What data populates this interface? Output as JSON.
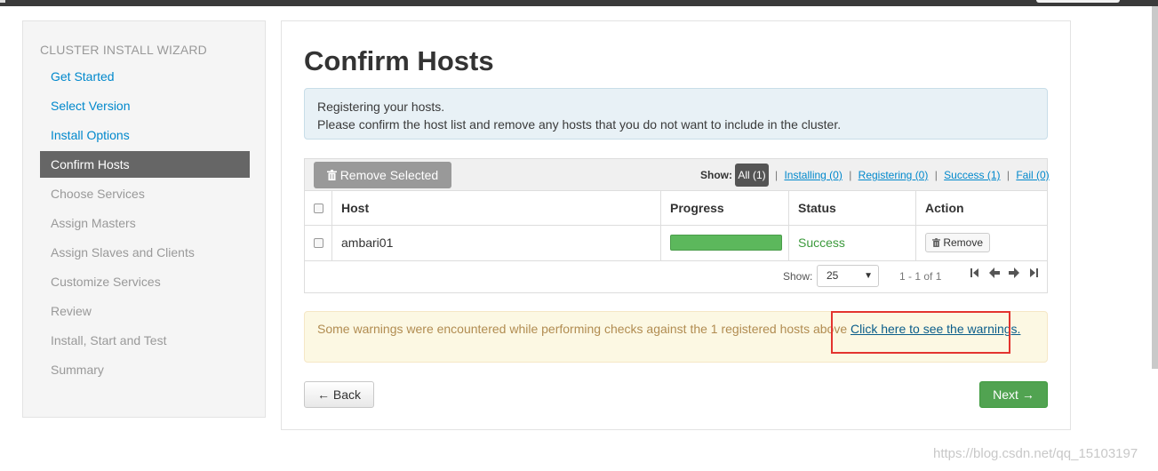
{
  "sidebar": {
    "title": "CLUSTER INSTALL WIZARD",
    "items": [
      {
        "label": "Get Started",
        "state": "link"
      },
      {
        "label": "Select Version",
        "state": "link"
      },
      {
        "label": "Install Options",
        "state": "link"
      },
      {
        "label": "Confirm Hosts",
        "state": "active"
      },
      {
        "label": "Choose Services",
        "state": "disabled"
      },
      {
        "label": "Assign Masters",
        "state": "disabled"
      },
      {
        "label": "Assign Slaves and Clients",
        "state": "disabled"
      },
      {
        "label": "Customize Services",
        "state": "disabled"
      },
      {
        "label": "Review",
        "state": "disabled"
      },
      {
        "label": "Install, Start and Test",
        "state": "disabled"
      },
      {
        "label": "Summary",
        "state": "disabled"
      }
    ]
  },
  "main": {
    "title": "Confirm Hosts",
    "info_line1": "Registering your hosts.",
    "info_line2": "Please confirm the host list and remove any hosts that you do not want to include in the cluster.",
    "toolbar": {
      "remove_selected_label": "Remove Selected",
      "show_label": "Show:",
      "filter_all": "All (1)",
      "filter_installing": "Installing (0)",
      "filter_registering": "Registering (0)",
      "filter_success": "Success (1)",
      "filter_fail": "Fail (0)",
      "separator": "|"
    },
    "table": {
      "headers": {
        "host": "Host",
        "progress": "Progress",
        "status": "Status",
        "action": "Action"
      },
      "rows": [
        {
          "host": "ambari01",
          "progress": 100,
          "status": "Success",
          "action_label": "Remove"
        }
      ]
    },
    "pager": {
      "show_label": "Show:",
      "page_size": "25",
      "range": "1 - 1 of 1"
    },
    "warning_text": "Some warnings were encountered while performing checks against the 1 registered hosts above ",
    "warning_link": "Click here to see the warnings.",
    "back_label": "← Back",
    "next_label": "Next →"
  },
  "watermark": "https://blog.csdn.net/qq_15103197",
  "colors": {
    "link": "#0088cc",
    "active_nav": "#666666",
    "success": "#5cb85c",
    "next_button": "#51a351",
    "warning_bg": "#fcf8e3",
    "highlight": "#e3342f"
  }
}
